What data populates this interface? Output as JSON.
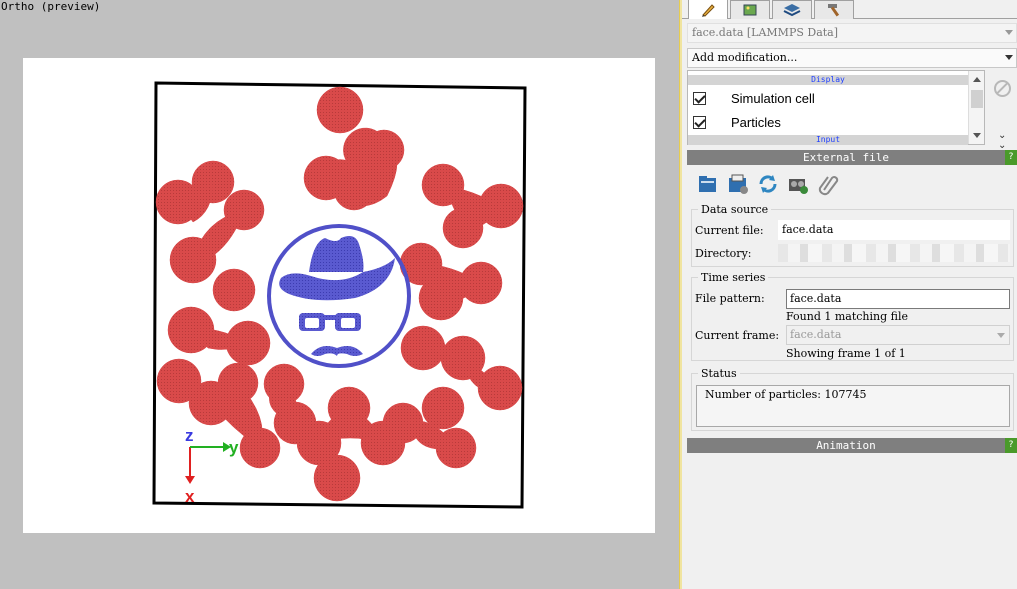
{
  "viewport": {
    "caption": "Ortho (preview)",
    "axis_tripod": {
      "z": "z",
      "y": "y",
      "x": "x"
    },
    "colors": {
      "particles_red": "#d94a4a",
      "particles_blue": "#5050c8",
      "cell_border": "#000000",
      "axis_z": "#3a3ae0",
      "axis_y": "#22b022",
      "axis_x": "#e02020"
    }
  },
  "panel": {
    "tabs": [
      {
        "icon": "pencil-icon",
        "active": true
      },
      {
        "icon": "image-icon",
        "active": false
      },
      {
        "icon": "layers-icon",
        "active": false
      },
      {
        "icon": "hammer-icon",
        "active": false
      }
    ],
    "source_combo": "face.data [LAMMPS Data]",
    "add_modification": "Add modification...",
    "pipeline": {
      "category_display": "Display",
      "category_input": "Input",
      "items": [
        {
          "label": "Simulation cell",
          "checked": true
        },
        {
          "label": "Particles",
          "checked": true
        }
      ]
    },
    "external_file": {
      "title": "External file",
      "help": "?",
      "toolbar_icons": [
        "pick-local-file-icon",
        "pick-remote-file-icon",
        "reload-icon",
        "scan-frames-icon",
        "attach-icon"
      ],
      "data_source": {
        "legend": "Data source",
        "current_file_label": "Current file:",
        "current_file": "face.data",
        "directory_label": "Directory:"
      },
      "time_series": {
        "legend": "Time series",
        "file_pattern_label": "File pattern:",
        "file_pattern": "face.data",
        "matching": "Found 1 matching file",
        "current_frame_label": "Current frame:",
        "current_frame": "face.data",
        "showing": "Showing frame 1 of 1"
      },
      "status": {
        "legend": "Status",
        "text": "Number of particles: 107745"
      }
    },
    "animation": {
      "title": "Animation",
      "help": "?"
    }
  }
}
